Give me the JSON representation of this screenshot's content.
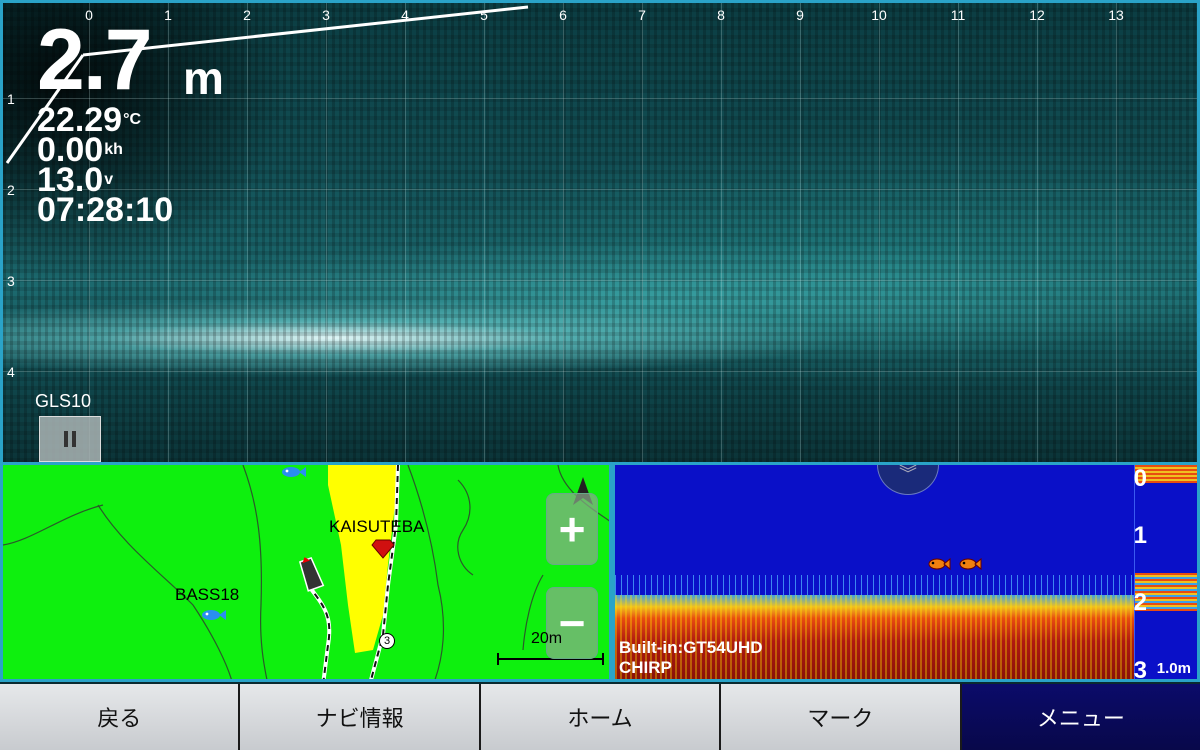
{
  "sonar": {
    "depth_value": "2.7",
    "depth_unit": "m",
    "water_temp": "22.29",
    "water_temp_unit": "°C",
    "speed": "0.00",
    "speed_unit": "kh",
    "voltage": "13.0",
    "voltage_unit": "v",
    "time": "07:28:10",
    "gain_label": "GLS10",
    "x_ticks": [
      "0",
      "1",
      "2",
      "3",
      "4",
      "5",
      "6",
      "7",
      "8",
      "9",
      "10",
      "11",
      "12",
      "13"
    ],
    "y_ticks": [
      "1",
      "2",
      "3",
      "4"
    ]
  },
  "map": {
    "waypoint_bass": "BASS18",
    "waypoint_kaisuteba": "KAISUTEBA",
    "scale_text": "20m",
    "zoom_in": "+",
    "zoom_out": "−",
    "route_marker": "3"
  },
  "sonar2": {
    "depth_ticks": [
      "0",
      "1",
      "2",
      "3"
    ],
    "zoom_scale": "1.0m",
    "transducer": "Built-in:GT54UHD",
    "mode": "CHIRP"
  },
  "navbar": {
    "back": "戻る",
    "navi_info": "ナビ情報",
    "home": "ホーム",
    "mark": "マーク",
    "menu": "メニュー"
  },
  "colors": {
    "border_accent": "#2aa3c8",
    "map_land": "#0ef00e",
    "map_water": "#ffff00",
    "sonar_bg": "#0a10c8",
    "menu_active": "#0b0b6a"
  }
}
